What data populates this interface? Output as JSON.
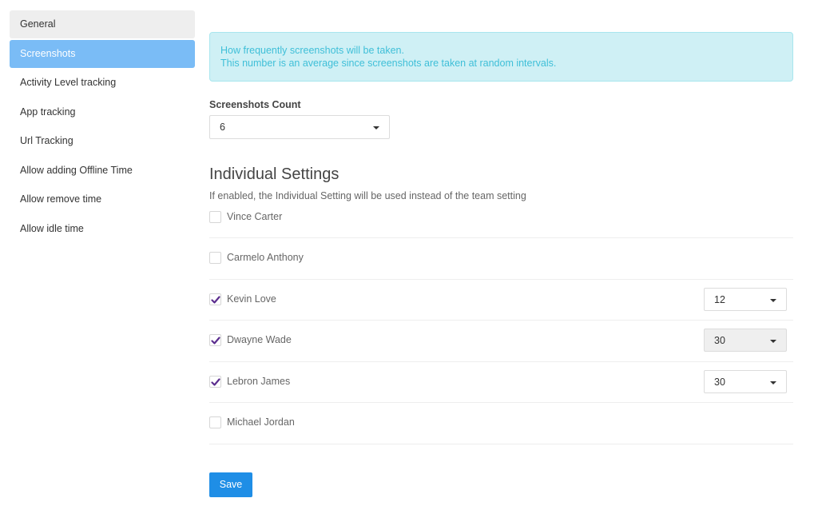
{
  "sidebar": {
    "items": [
      {
        "label": "General",
        "state": "hover"
      },
      {
        "label": "Screenshots",
        "state": "active"
      },
      {
        "label": "Activity Level tracking"
      },
      {
        "label": "App tracking"
      },
      {
        "label": "Url Tracking"
      },
      {
        "label": "Allow adding Offline Time"
      },
      {
        "label": "Allow remove time"
      },
      {
        "label": "Allow idle time"
      }
    ]
  },
  "main": {
    "alert": {
      "line1": "How frequently screenshots will be taken.",
      "line2": "This number is an average since screenshots are taken at random intervals."
    },
    "screenshots_count": {
      "label": "Screenshots Count",
      "value": "6"
    },
    "individual": {
      "title": "Individual Settings",
      "description": "If enabled, the Individual Setting will be used instead of the team setting",
      "users": [
        {
          "name": "Vince Carter",
          "checked": false
        },
        {
          "name": "Carmelo Anthony",
          "checked": false
        },
        {
          "name": "Kevin Love",
          "checked": true,
          "value": "12"
        },
        {
          "name": "Dwayne Wade",
          "checked": true,
          "value": "30",
          "disabled": true
        },
        {
          "name": "Lebron James",
          "checked": true,
          "value": "30"
        },
        {
          "name": "Michael Jordan",
          "checked": false
        }
      ]
    },
    "save_label": "Save"
  },
  "colors": {
    "active_nav": "#7abcf6",
    "alert_bg": "#cff0f5",
    "alert_text": "#3fbfd8",
    "check_color": "#5b2d8e",
    "save_button": "#1f8ee6"
  }
}
